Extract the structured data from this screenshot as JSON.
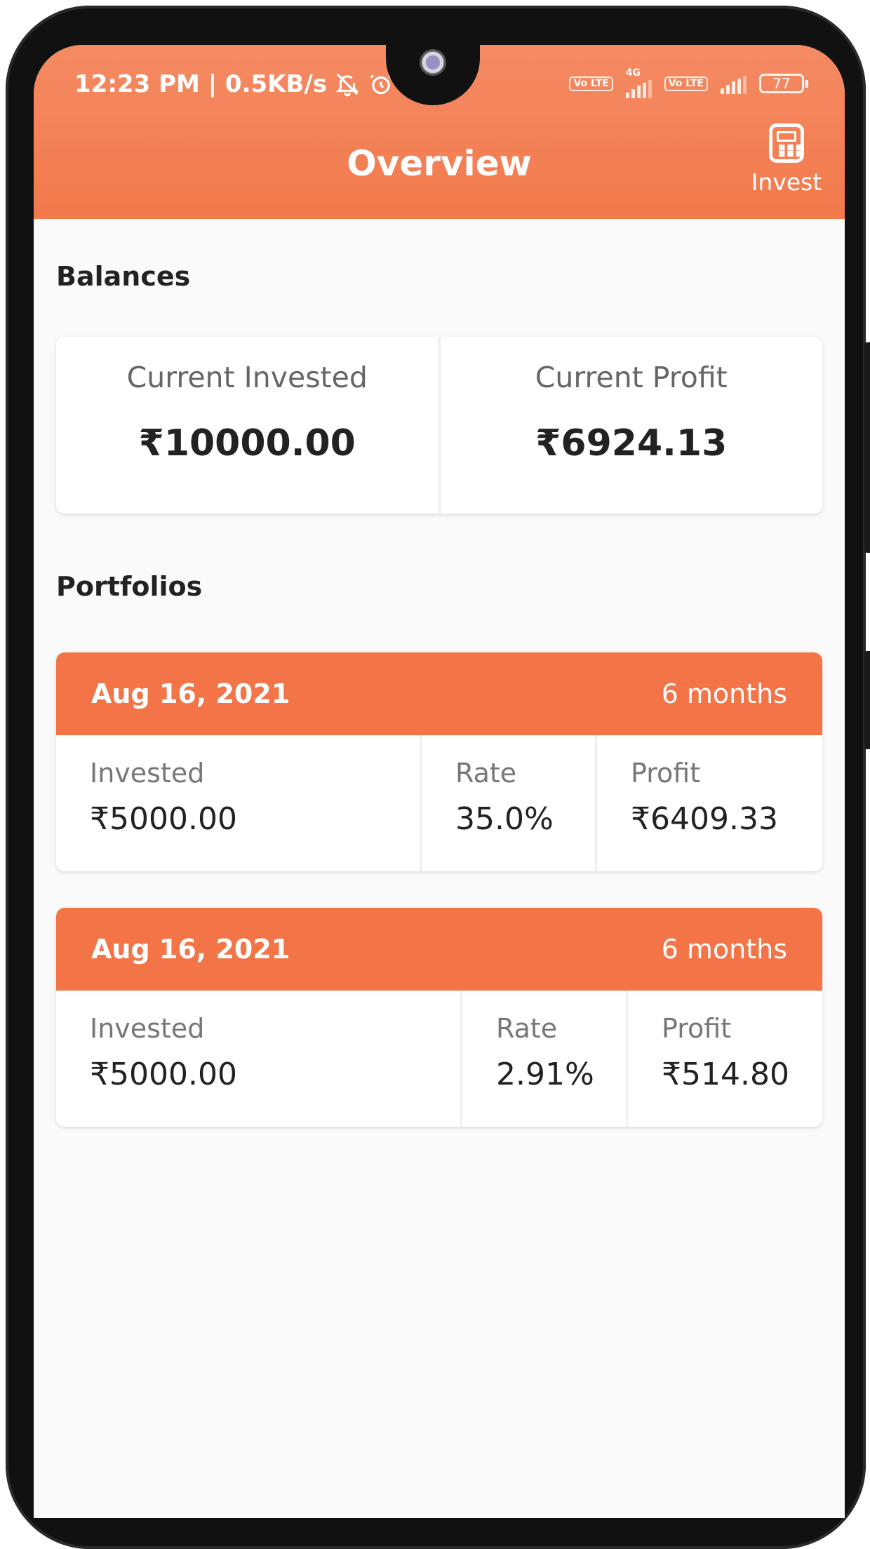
{
  "status_bar": {
    "time_info": "12:23 PM | 0.5KB/s",
    "volte_label": "Vo LTE",
    "network_label": "4G",
    "battery": "77"
  },
  "header": {
    "title": "Overview",
    "invest_label": "Invest",
    "color": "#f27a4c"
  },
  "balances": {
    "section_title": "Balances",
    "current_invested_label": "Current Invested",
    "current_invested_value": "₹10000.00",
    "current_profit_label": "Current Profit",
    "current_profit_value": "₹6924.13"
  },
  "portfolios": {
    "section_title": "Portfolios",
    "items": [
      {
        "date": "Aug 16, 2021",
        "term": "6 months",
        "invested_label": "Invested",
        "invested": "₹5000.00",
        "rate_label": "Rate",
        "rate": "35.0%",
        "profit_label": "Profit",
        "profit": "₹6409.33"
      },
      {
        "date": "Aug 16, 2021",
        "term": "6 months",
        "invested_label": "Invested",
        "invested": "₹5000.00",
        "rate_label": "Rate",
        "rate": "2.91%",
        "profit_label": "Profit",
        "profit": "₹514.80"
      }
    ]
  }
}
